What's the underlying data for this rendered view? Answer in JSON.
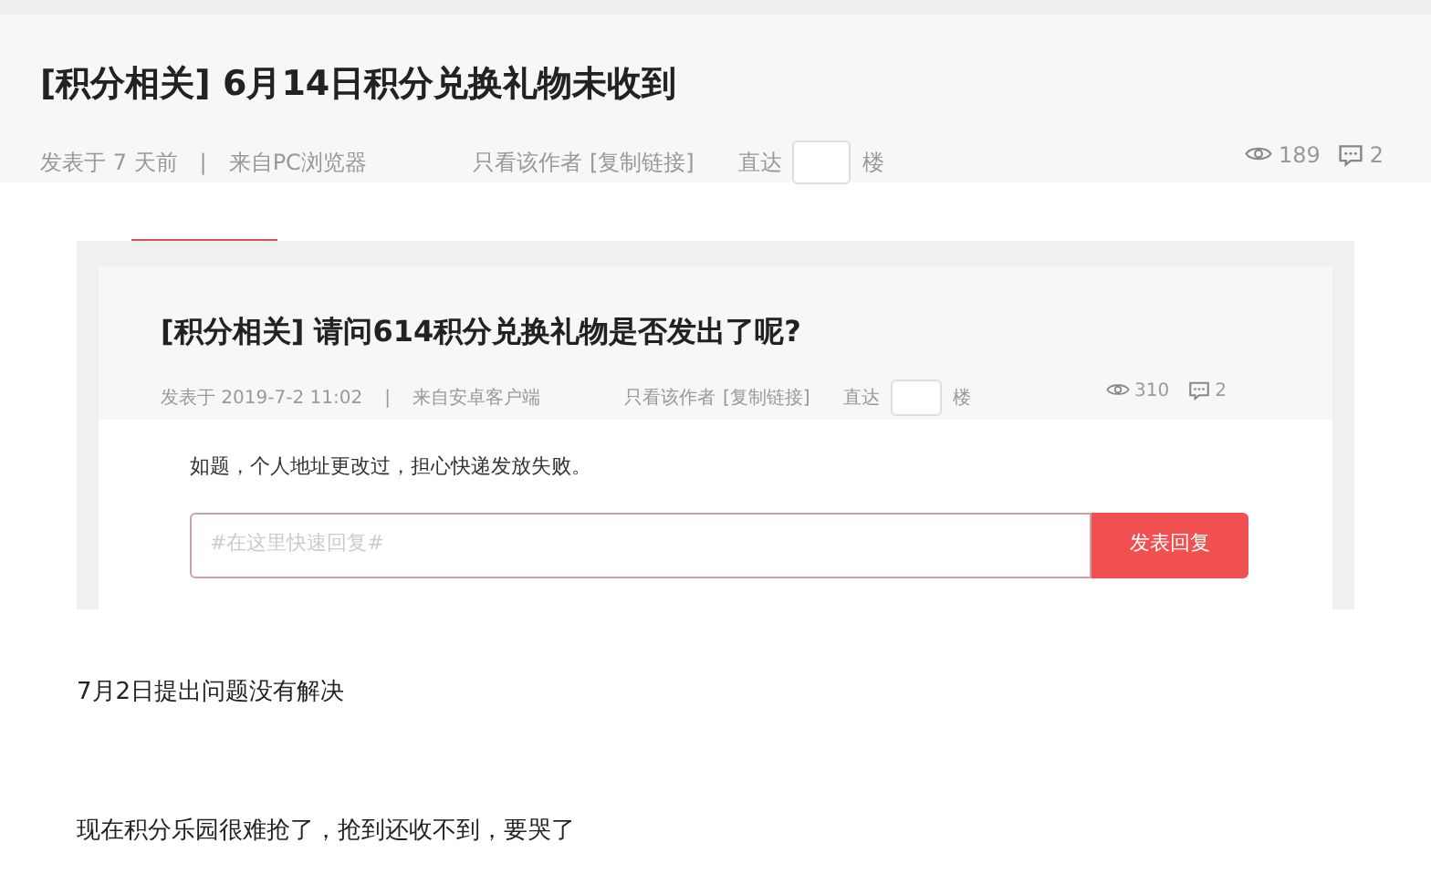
{
  "post": {
    "title": "[积分相关] 6月14日积分兑换礼物未收到",
    "posted": "发表于 7 天前",
    "separator": "|",
    "source": "来自PC浏览器",
    "only_author": "只看该作者",
    "copy_link": "[复制链接]",
    "jump_label": "直达",
    "jump_suffix": "楼",
    "views": "189",
    "comments": "2"
  },
  "embedded_screenshot": {
    "title": "[积分相关] 请问614积分兑换礼物是否发出了呢?",
    "posted": "发表于 2019-7-2 11:02",
    "separator": "|",
    "source": "来自安卓客户端",
    "only_author": "只看该作者",
    "copy_link": "[复制链接]",
    "jump_label": "直达",
    "jump_suffix": "楼",
    "views": "310",
    "comments": "2",
    "body": "如题，个人地址更改过，担心快递发放失败。",
    "reply": {
      "placeholder": "#在这里快速回复#",
      "button": "发表回复"
    }
  },
  "paragraphs": [
    "7月2日提出问题没有解决",
    "现在积分乐园很难抢了，抢到还收不到，要哭了"
  ]
}
